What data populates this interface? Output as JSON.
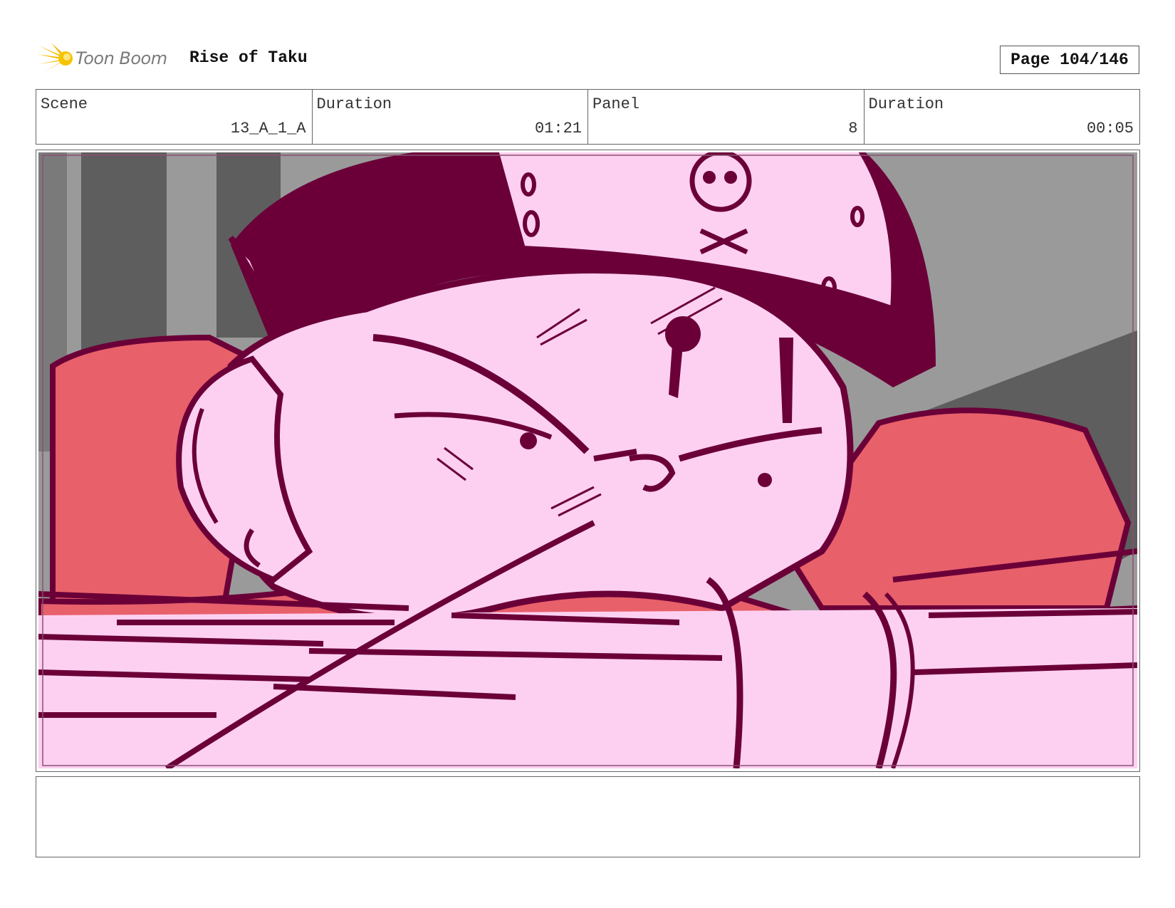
{
  "header": {
    "logo_text": "Toon Boom",
    "project_title": "Rise of Taku",
    "page_label": "Page 104/146"
  },
  "info": {
    "scene_label": "Scene",
    "scene_value": "13_A_1_A",
    "scene_duration_label": "Duration",
    "scene_duration_value": "01:21",
    "panel_label": "Panel",
    "panel_value": "8",
    "panel_duration_label": "Duration",
    "panel_duration_value": "00:05"
  },
  "colors": {
    "skin": "#fdd0f2",
    "ink": "#6b0038",
    "cloak": "#e8606a",
    "bg_dark": "#5e5e5e",
    "bg_light": "#9a9a9a",
    "logo_burst": "#f5b800"
  },
  "notes": {
    "text": ""
  }
}
